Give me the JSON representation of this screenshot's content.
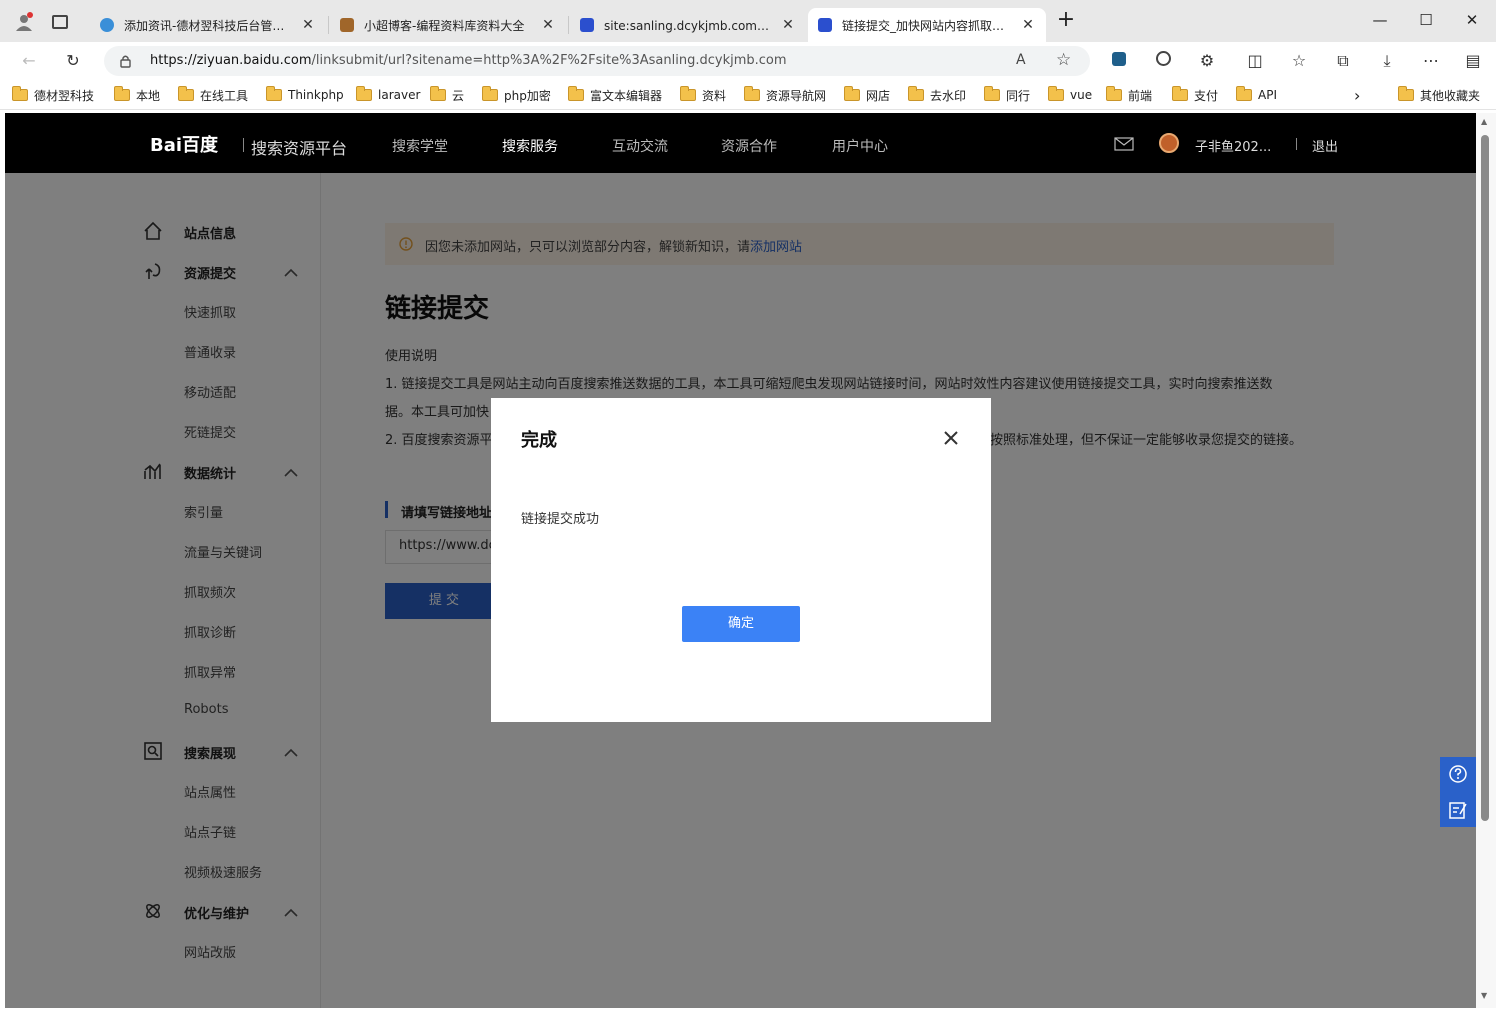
{
  "browser": {
    "tabs": [
      {
        "title": "添加资讯-德材翌科技后台管理系统",
        "color": "#3a8fd8"
      },
      {
        "title": "小超博客-编程资料库资料大全",
        "color": "#a0662a"
      },
      {
        "title": "site:sanling.dcykjmb.com_百度搜索",
        "color": "#2b4fce"
      },
      {
        "title": "链接提交_加快网站内容抓取，快速提交数据工具",
        "color": "#2b4fce"
      }
    ],
    "url_host": "https://ziyuan.baidu.com",
    "url_path": "/linksubmit/url?sitename=http%3A%2F%2Fsite%3Asanling.dcykjmb.com",
    "bookmarks": [
      "德材翌科技",
      "本地",
      "在线工具",
      "Thinkphp",
      "laraver",
      "云",
      "php加密",
      "富文本编辑器",
      "资料",
      "资源导航网",
      "网店",
      "去水印",
      "同行",
      "vue",
      "前端",
      "支付",
      "API"
    ],
    "other_bookmarks": "其他收藏夹"
  },
  "header": {
    "logo_text": "Bai百度",
    "platform": "搜索资源平台",
    "nav": [
      "搜索学堂",
      "搜索服务",
      "互动交流",
      "资源合作",
      "用户中心"
    ],
    "username": "子非鱼202...",
    "logout": "退出"
  },
  "sidebar": {
    "site_info": "站点信息",
    "groups": [
      {
        "label": "资源提交",
        "items": [
          "快速抓取",
          "普通收录",
          "移动适配",
          "死链提交"
        ]
      },
      {
        "label": "数据统计",
        "items": [
          "索引量",
          "流量与关键词",
          "抓取频次",
          "抓取诊断",
          "抓取异常",
          "Robots"
        ]
      },
      {
        "label": "搜索展现",
        "items": [
          "站点属性",
          "站点子链",
          "视频极速服务"
        ]
      },
      {
        "label": "优化与维护",
        "items": [
          "网站改版"
        ]
      }
    ]
  },
  "main": {
    "notice_text": "因您未添加网站，只可以浏览部分内容，解锁新知识，请",
    "notice_link": "添加网站",
    "title": "链接提交",
    "usage_heading": "使用说明",
    "line1": "1. 链接提交工具是网站主动向百度搜索推送数据的工具，本工具可缩短爬虫发现网站链接时间，网站时效性内容建议使用链接提交工具，实时向搜索推送数",
    "line2": "据。本工具可加快",
    "line3a": "2. 百度搜索资源平",
    "line3b": "按照标准处理，但不保证一定能够收录您提交的链接。",
    "form_label": "请填写链接地址",
    "input_value": "https://www.dcy",
    "submit_label": "提 交"
  },
  "modal": {
    "title": "完成",
    "message": "链接提交成功",
    "ok_label": "确定"
  }
}
